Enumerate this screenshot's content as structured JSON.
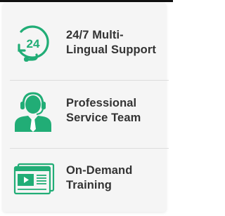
{
  "colors": {
    "accent": "#21ad76",
    "text": "#333333",
    "card_bg": "#f5f5f5",
    "divider": "#dcdcdc"
  },
  "features": [
    {
      "icon": "24-hour-support-headset-icon",
      "line1": "24/7 Multi-",
      "line2": "Lingual Support"
    },
    {
      "icon": "customer-service-agent-icon",
      "line1": "Professional",
      "line2": "Service Team"
    },
    {
      "icon": "video-training-screen-icon",
      "line1": "On-Demand",
      "line2": "Training"
    }
  ]
}
